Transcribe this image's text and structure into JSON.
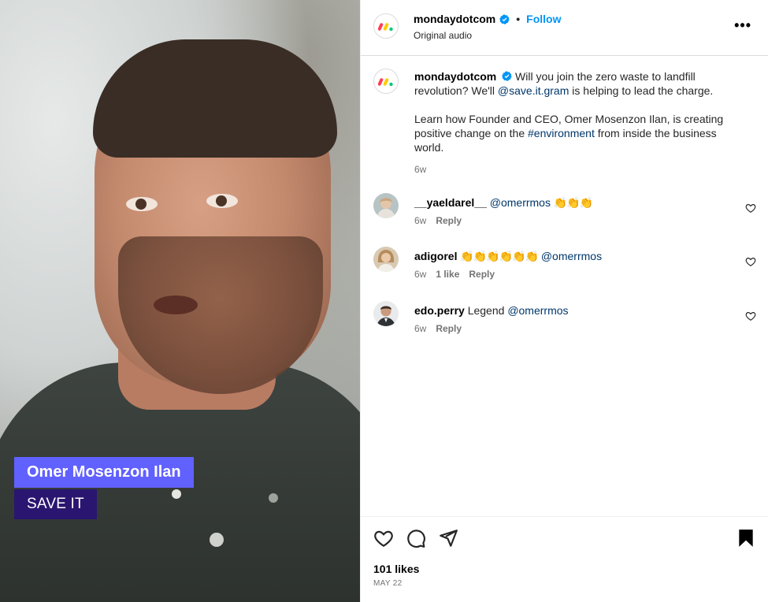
{
  "media": {
    "name_label": "Omer Mosenzon Ilan",
    "tag_label": "SAVE IT"
  },
  "header": {
    "account": "mondaydotcom",
    "separator": "•",
    "follow_label": "Follow",
    "audio": "Original audio",
    "more": "•••"
  },
  "caption": {
    "user": "mondaydotcom",
    "text_a": " Will you join the zero waste to landfill revolution? We'll ",
    "mention": "@save.it.gram",
    "text_b": " is helping to lead the charge.",
    "text_c": "Learn how Founder and CEO, Omer Mosenzon Ilan, is creating positive change on the ",
    "hashtag": "#environment",
    "text_d": " from inside the business world.",
    "time": "6w"
  },
  "comments": [
    {
      "user": "__yaeldarel__",
      "mention": "@omerrmos",
      "emoji": "👏👏👏",
      "emoji_before": false,
      "text": "",
      "time": "6w",
      "likes": "",
      "reply": "Reply"
    },
    {
      "user": "adigorel",
      "mention": "@omerrmos",
      "emoji": "👏👏👏👏👏👏",
      "emoji_before": true,
      "text": "",
      "time": "6w",
      "likes": "1 like",
      "reply": "Reply"
    },
    {
      "user": "edo.perry",
      "mention": "@omerrmos",
      "emoji": "",
      "emoji_before": false,
      "text": "Legend",
      "time": "6w",
      "likes": "",
      "reply": "Reply"
    }
  ],
  "footer": {
    "likes": "101 likes",
    "date": "MAY 22"
  },
  "colors": {
    "accent": "#0095f6",
    "link": "#00376b",
    "name_bar": "#6161ff",
    "tag_bar": "#2a1670"
  },
  "icons": [
    "monday-logo-icon",
    "verified-icon",
    "more-options-icon",
    "heart-icon",
    "comment-icon",
    "share-icon",
    "bookmark-icon"
  ]
}
